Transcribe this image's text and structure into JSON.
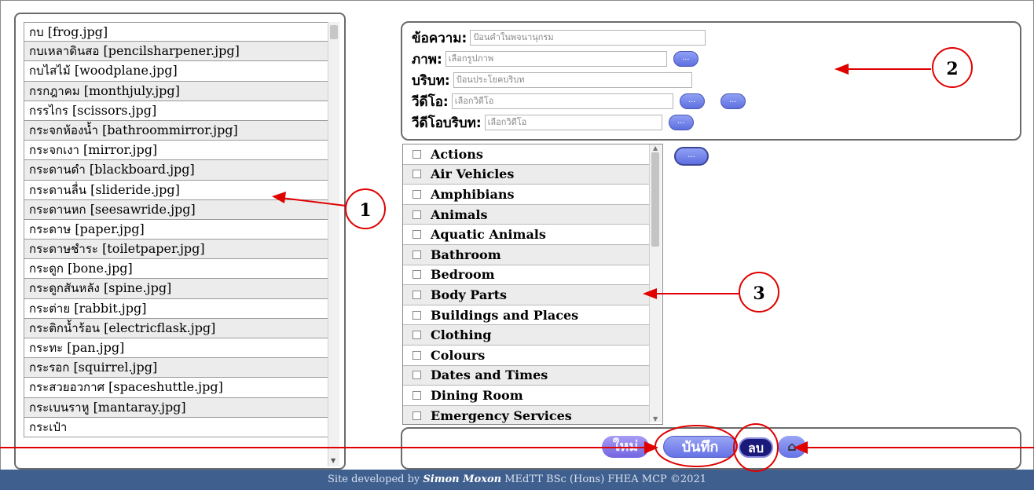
{
  "word_list": [
    {
      "thai": "กบ",
      "file": "[frog.jpg]"
    },
    {
      "thai": "กบเหลาดินสอ",
      "file": "[pencilsharpener.jpg]"
    },
    {
      "thai": "กบไสไม้",
      "file": "[woodplane.jpg]"
    },
    {
      "thai": "กรกฎาคม",
      "file": "[monthjuly.jpg]"
    },
    {
      "thai": "กรรไกร",
      "file": "[scissors.jpg]"
    },
    {
      "thai": "กระจกห้องน้ำ",
      "file": "[bathroommirror.jpg]"
    },
    {
      "thai": "กระจกเงา",
      "file": "[mirror.jpg]"
    },
    {
      "thai": "กระดานดำ",
      "file": "[blackboard.jpg]"
    },
    {
      "thai": "กระดานลื่น",
      "file": "[slideride.jpg]"
    },
    {
      "thai": "กระดานหก",
      "file": "[seesawride.jpg]"
    },
    {
      "thai": "กระดาษ",
      "file": "[paper.jpg]"
    },
    {
      "thai": "กระดาษชำระ",
      "file": "[toiletpaper.jpg]"
    },
    {
      "thai": "กระดูก",
      "file": "[bone.jpg]"
    },
    {
      "thai": "กระดูกสันหลัง",
      "file": "[spine.jpg]"
    },
    {
      "thai": "กระต่าย",
      "file": "[rabbit.jpg]"
    },
    {
      "thai": "กระติกน้ำร้อน",
      "file": "[electricflask.jpg]"
    },
    {
      "thai": "กระทะ",
      "file": "[pan.jpg]"
    },
    {
      "thai": "กระรอก",
      "file": "[squirrel.jpg]"
    },
    {
      "thai": "กระสวยอวกาศ",
      "file": "[spaceshuttle.jpg]"
    },
    {
      "thai": "กระเบนราหู",
      "file": "[mantaray.jpg]"
    },
    {
      "thai": "กระเป๋า",
      "file": ""
    }
  ],
  "form": {
    "text_label": "ข้อความ:",
    "text_placeholder": "ป้อนคำในพจนานุกรม",
    "image_label": "ภาพ:",
    "image_placeholder": "เลือกรูปภาพ",
    "context_label": "บริบท:",
    "context_placeholder": "ป้อนประโยคบริบท",
    "video_label": "วีดีโอ:",
    "video_placeholder": "เลือกวิดีโอ",
    "video_context_label": "วีดีโอบริบท:",
    "video_context_placeholder": "เลือกวิดีโอ",
    "browse_label": "..."
  },
  "categories": [
    "Actions",
    "Air Vehicles",
    "Amphibians",
    "Animals",
    "Aquatic Animals",
    "Bathroom",
    "Bedroom",
    "Body Parts",
    "Buildings and Places",
    "Clothing",
    "Colours",
    "Dates and Times",
    "Dining Room",
    "Emergency Services"
  ],
  "category_button_label": "...",
  "actions": {
    "new_label": "ใหม่",
    "save_label": "บันทึก",
    "delete_label": "ลบ",
    "home_icon": "home-icon"
  },
  "annotations": [
    "1",
    "2",
    "3"
  ],
  "footer": {
    "prefix": "Site developed by ",
    "author": "Simon Moxon",
    "suffix": "  MEdTT  BSc (Hons)  FHEA  MCP  ©2021"
  },
  "colors": {
    "annotation_red": "#e00000",
    "footer_blue": "#3f5f8f",
    "button_blue": "#6472e6",
    "delete_navy": "#1a1a7a"
  }
}
